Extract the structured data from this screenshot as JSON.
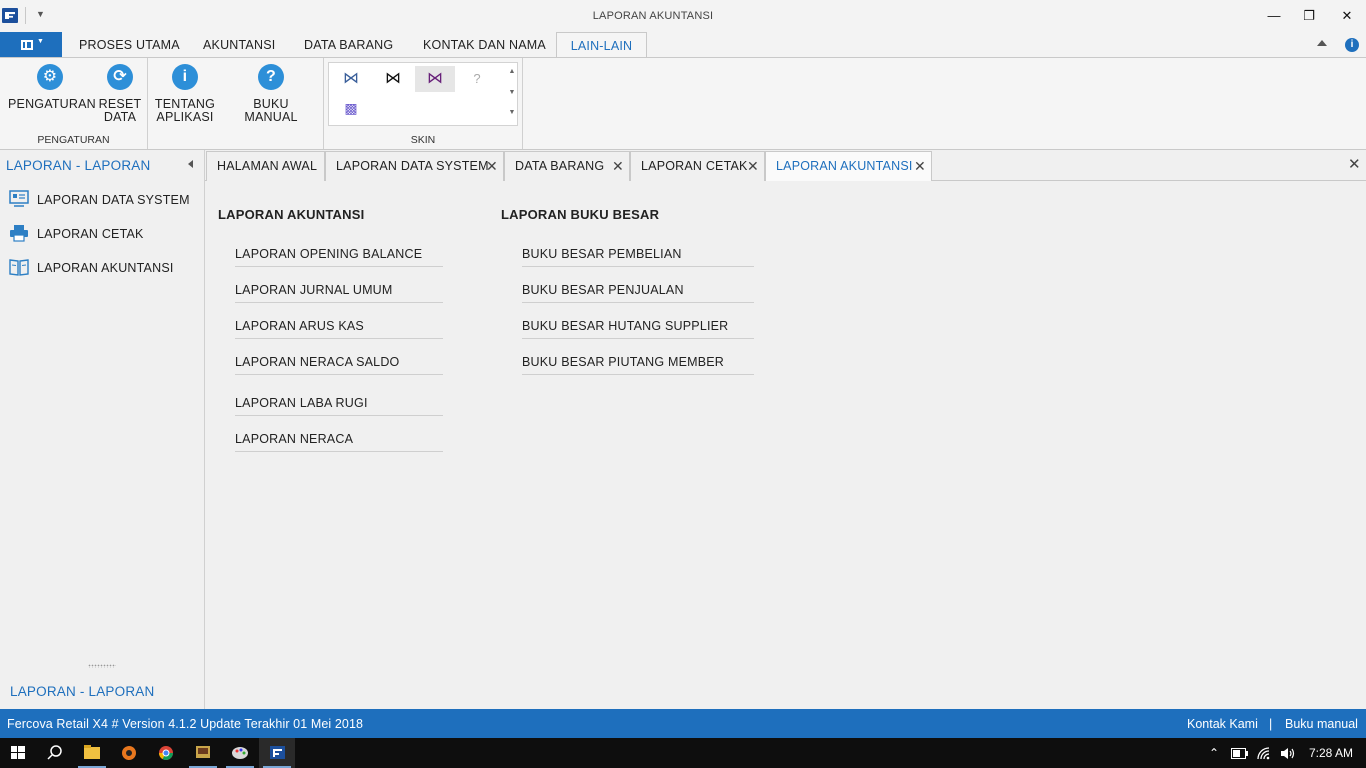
{
  "window": {
    "title": "LAPORAN AKUNTANSI",
    "minimize_glyph": "—",
    "restore_glyph": "❐",
    "close_glyph": "✕"
  },
  "ribbon": {
    "tabs": [
      {
        "label": "PROSES UTAMA"
      },
      {
        "label": "AKUNTANSI"
      },
      {
        "label": "DATA BARANG"
      },
      {
        "label": "KONTAK DAN NAMA"
      },
      {
        "label": "LAIN-LAIN"
      }
    ],
    "active_tab": "LAIN-LAIN",
    "groups": {
      "pengaturan": {
        "label": "PENGATURAN",
        "buttons": [
          {
            "label": "PENGATURAN",
            "icon": "gear-icon"
          },
          {
            "label": "RESET",
            "label2": "DATA",
            "icon": "refresh-icon"
          }
        ]
      },
      "info": {
        "buttons": [
          {
            "label": "TENTANG",
            "label2": "APLIKASI",
            "icon": "info-icon"
          },
          {
            "label": "BUKU MANUAL",
            "icon": "help-icon"
          }
        ]
      },
      "skin": {
        "label": "SKIN"
      }
    }
  },
  "sidebar": {
    "header": "LAPORAN - LAPORAN",
    "items": [
      {
        "label": "LAPORAN DATA SYSTEM",
        "icon": "monitor-card-icon"
      },
      {
        "label": "LAPORAN CETAK",
        "icon": "printer-icon"
      },
      {
        "label": "LAPORAN AKUNTANSI",
        "icon": "book-icon"
      }
    ],
    "footer": "LAPORAN - LAPORAN"
  },
  "doc_tabs": [
    {
      "label": "HALAMAN AWAL"
    },
    {
      "label": "LAPORAN DATA SYSTEM"
    },
    {
      "label": "DATA BARANG"
    },
    {
      "label": "LAPORAN CETAK"
    },
    {
      "label": "LAPORAN AKUNTANSI"
    }
  ],
  "content": {
    "akuntansi": {
      "title": "LAPORAN AKUNTANSI",
      "links": [
        "LAPORAN OPENING BALANCE",
        "LAPORAN JURNAL UMUM",
        "LAPORAN ARUS KAS",
        "LAPORAN NERACA SALDO",
        "LAPORAN LABA RUGI",
        "LAPORAN NERACA"
      ]
    },
    "buku_besar": {
      "title": "LAPORAN BUKU BESAR",
      "links": [
        "BUKU BESAR PEMBELIAN",
        "BUKU BESAR PENJUALAN",
        "BUKU BESAR HUTANG SUPPLIER",
        "BUKU BESAR PIUTANG MEMBER"
      ]
    }
  },
  "status": {
    "version": "Fercova Retail X4 # Version 4.1.2 Update Terakhir 01 Mei 2018",
    "contact": "Kontak Kami",
    "separator": "|",
    "manual": "Buku manual"
  },
  "taskbar": {
    "clock": "7:28 AM"
  },
  "colors": {
    "accent": "#1e6fbd",
    "taskbar": "#0e0e0e"
  }
}
